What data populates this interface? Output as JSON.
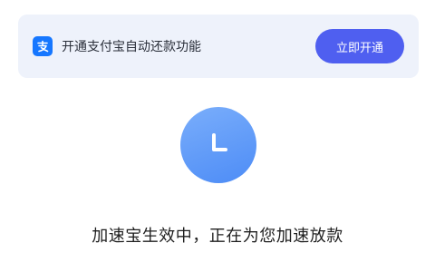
{
  "banner": {
    "icon": "alipay-icon",
    "text": "开通支付宝自动还款功能",
    "button_label": "立即开通",
    "accent_color": "#4f5ff0",
    "icon_color": "#1677ff"
  },
  "status": {
    "icon": "clock-icon",
    "text": "加速宝生效中，正在为您加速放款"
  }
}
